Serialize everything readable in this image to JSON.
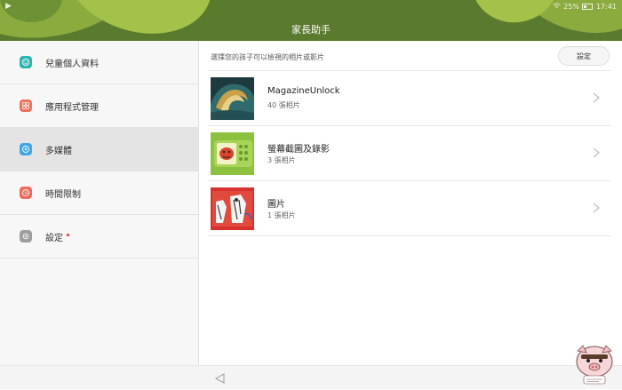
{
  "status_bar": {
    "left_icon": "play-icon",
    "battery": "25%",
    "time": "17:41"
  },
  "header": {
    "title": "家長助手"
  },
  "sidebar": {
    "items": [
      {
        "label": "兒童個人資料",
        "icon": "child-profile-icon",
        "color": "#2ab7b0",
        "active": false
      },
      {
        "label": "應用程式管理",
        "icon": "apps-icon",
        "color": "#f07058",
        "active": false
      },
      {
        "label": "多媒體",
        "icon": "multimedia-icon",
        "color": "#3fa6e8",
        "active": true
      },
      {
        "label": "時間限制",
        "icon": "clock-icon",
        "color": "#f06a5a",
        "active": false
      },
      {
        "label": "設定",
        "icon": "gear-icon",
        "color": "#9e9e9e",
        "active": false,
        "badge": true
      }
    ]
  },
  "main": {
    "hint": "選擇您的孩子可以檢視的相片或影片",
    "settings_label": "設定",
    "albums": [
      {
        "title": "MagazineUnlock",
        "count": "40 張相片"
      },
      {
        "title": "螢幕截圖及錄影",
        "count": "3 張相片"
      },
      {
        "title": "圖片",
        "count": "1 張相片"
      }
    ]
  },
  "colors": {
    "header_green": "#5a7a2e",
    "active_item_bg": "#e4e4e4",
    "badge_red": "#e53935"
  }
}
